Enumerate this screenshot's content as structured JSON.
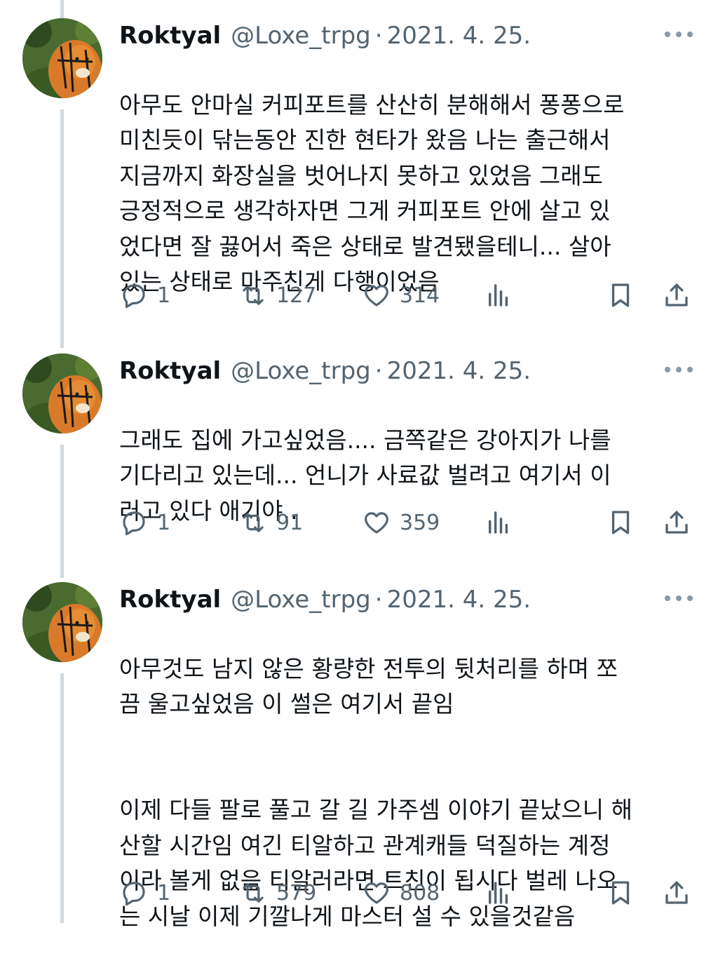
{
  "colors": {
    "text": "#0f1419",
    "secondary": "#536471",
    "thread_line": "#cfd9de"
  },
  "tweets": [
    {
      "name": "Roktyal",
      "handle": "@Loxe_trpg",
      "sep": "·",
      "date": "2021. 4. 25.",
      "paragraphs": [
        "아무도 안마실 커피포트를 산산히 분해해서 퐁퐁으로\n미친듯이 닦는동안 진한 현타가 왔음 나는 출근해서\n지금까지 화장실을 벗어나지 못하고 있었음 그래도\n긍정적으로 생각하자면 그게 커피포트 안에 살고 있\n었다면 잘 끓어서 죽은 상태로 발견됐을테니... 살아\n있는 상태로 마주친게 다행이었음"
      ],
      "replies": "1",
      "retweets": "127",
      "likes": "314"
    },
    {
      "name": "Roktyal",
      "handle": "@Loxe_trpg",
      "sep": "·",
      "date": "2021. 4. 25.",
      "paragraphs": [
        "그래도 집에 가고싶었음.... 금쪽같은 강아지가 나를\n기다리고 있는데... 언니가 사료값 벌려고 여기서 이\n러고 있다 애기야.."
      ],
      "replies": "1",
      "retweets": "91",
      "likes": "359"
    },
    {
      "name": "Roktyal",
      "handle": "@Loxe_trpg",
      "sep": "·",
      "date": "2021. 4. 25.",
      "paragraphs": [
        "아무것도 남지 않은 황량한 전투의 뒷처리를 하며 쪼\n끔 울고싶었음 이 썰은 여기서 끝임",
        "이제 다들 팔로 풀고 갈 길 가주셈 이야기 끝났으니 해\n산할 시간임 여긴 티알하고 관계캐들 덕질하는 계정\n이라 볼게 없음 티알러라면 트친이 됩시다 벌레 나오\n는 시날 이제 기깔나게 마스터 설 수 있을것같음"
      ],
      "replies": "1",
      "retweets": "579",
      "likes": "808"
    }
  ]
}
